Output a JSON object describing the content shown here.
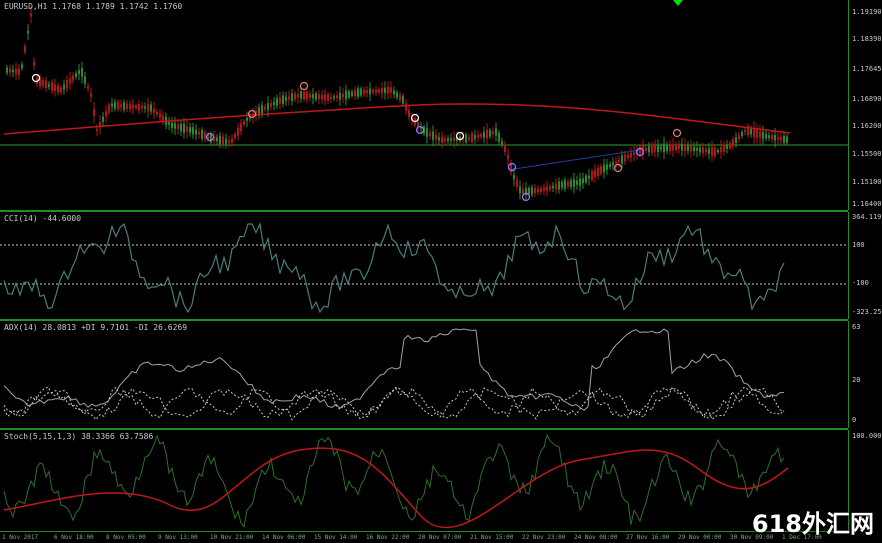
{
  "colors": {
    "background": "#000000",
    "separator": "#1f8f1f",
    "ma": "#c01818",
    "ema_blue": "#2a3a9a",
    "cci": "#4c7c7c",
    "adx_main": "#9aa6a6",
    "adx_dash": "#c8c8c8",
    "stoch_main": "#2e6e2e",
    "stoch_signal": "#c01818",
    "bull": "#2e8a2e",
    "bear": "#b01818"
  },
  "main": {
    "title": "EURUSD,H1  1.1768  1.1789  1.1742  1.1760",
    "price_ticks": [
      "1.19190",
      "1.18390",
      "1.17645",
      "1.16890",
      "1.16200",
      "1.15500",
      "1.15100",
      "1.16400"
    ]
  },
  "cci": {
    "title": "CCI(14) -44.6000",
    "ticks": [
      "364.1190",
      "100",
      "-100",
      "-323.2574"
    ]
  },
  "adx": {
    "title": "ADX(14) 28.0813  +DI 9.7101  -DI 26.6269",
    "ticks": [
      "63",
      "20",
      "0"
    ]
  },
  "stoch": {
    "title": "Stoch(5,15,1,3) 38.3366  63.7586",
    "ticks": [
      "100.0000",
      "0"
    ]
  },
  "time_labels": [
    "1 Nov 2017",
    "6 Nov 18:00",
    "8 Nov 05:00",
    "9 Nov 13:00",
    "10 Nov 21:00",
    "14 Nov 06:00",
    "15 Nov 14:00",
    "16 Nov 22:00",
    "20 Nov 07:00",
    "21 Nov 15:00",
    "22 Nov 23:00",
    "24 Nov 08:00",
    "27 Nov 16:00",
    "29 Nov 00:00",
    "30 Nov 09:00",
    "1 Dec 17:00"
  ],
  "watermark": "618外汇网"
}
